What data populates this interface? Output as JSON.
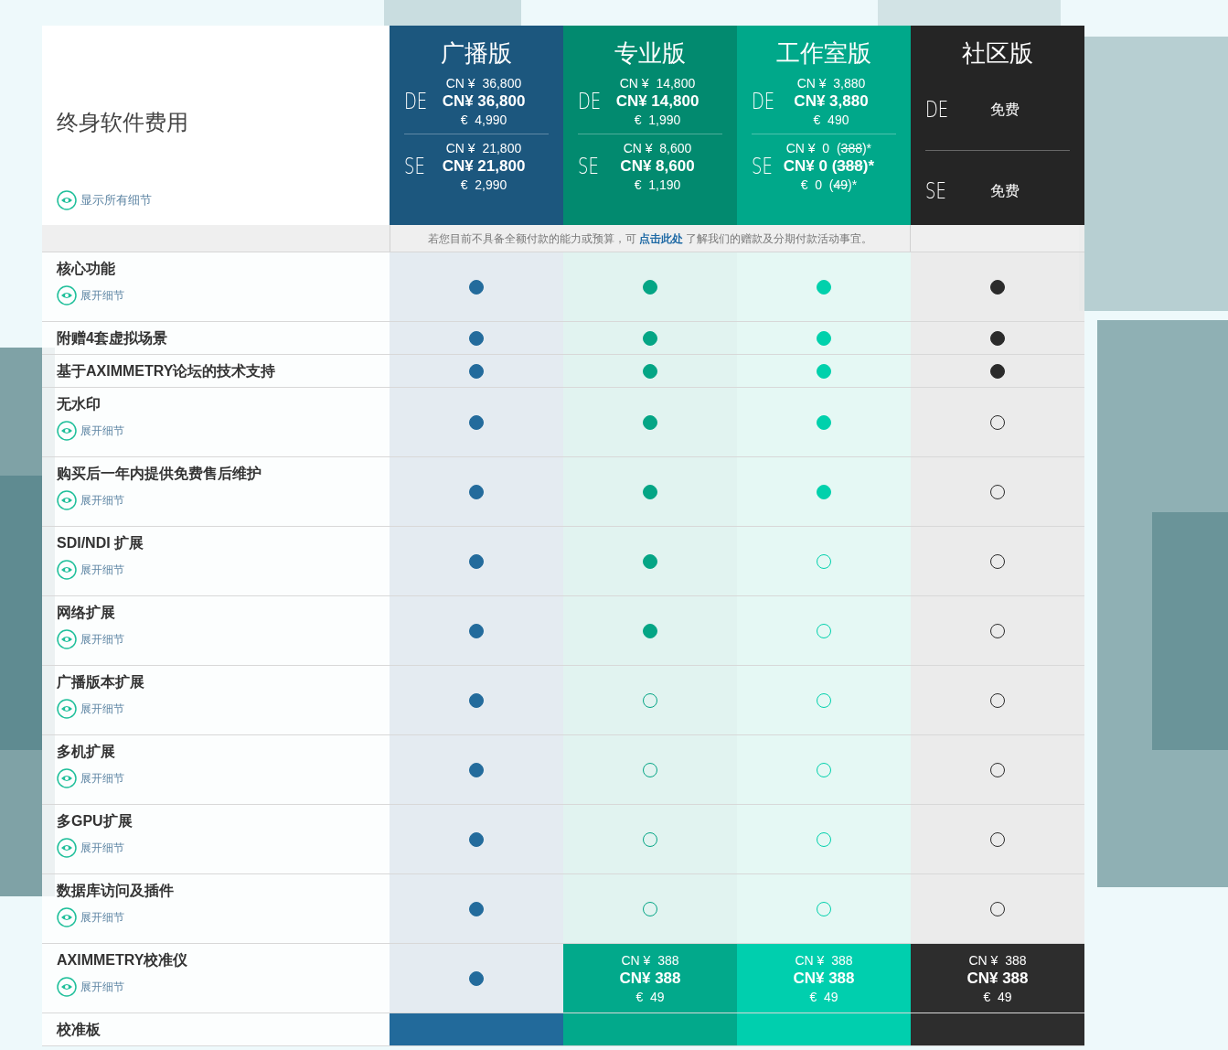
{
  "header": {
    "title": "终身软件费用",
    "show_all": "显示所有细节"
  },
  "editions": [
    {
      "name": "广播版",
      "tiers": [
        {
          "label": "DE",
          "kind": "price",
          "lines": [
            {
              "text": "CN ¥  36,800"
            },
            {
              "text": "CN¥ 36,800"
            },
            {
              "text": "€  4,990"
            }
          ]
        },
        {
          "label": "SE",
          "kind": "price",
          "lines": [
            {
              "text": "CN ¥  21,800"
            },
            {
              "text": "CN¥ 21,800"
            },
            {
              "text": "€  2,990"
            }
          ]
        }
      ]
    },
    {
      "name": "专业版",
      "tiers": [
        {
          "label": "DE",
          "kind": "price",
          "lines": [
            {
              "text": "CN ¥  14,800"
            },
            {
              "text": "CN¥ 14,800"
            },
            {
              "text": "€  1,990"
            }
          ]
        },
        {
          "label": "SE",
          "kind": "price",
          "lines": [
            {
              "text": "CN ¥  8,600"
            },
            {
              "text": "CN¥ 8,600"
            },
            {
              "text": "€  1,190"
            }
          ]
        }
      ]
    },
    {
      "name": "工作室版",
      "tiers": [
        {
          "label": "DE",
          "kind": "price",
          "lines": [
            {
              "text": "CN ¥  3,880"
            },
            {
              "text": "CN¥ 3,880"
            },
            {
              "text": "€  490"
            }
          ]
        },
        {
          "label": "SE",
          "kind": "price",
          "lines": [
            {
              "text": "CN ¥  0  (",
              "struck": "388",
              "after": ")*"
            },
            {
              "text": "CN¥ 0 (",
              "struck": "388",
              "after": ")*"
            },
            {
              "text": "€  0  (",
              "struck": "49",
              "after": ")*"
            }
          ]
        }
      ]
    },
    {
      "name": "社区版",
      "tiers": [
        {
          "label": "DE",
          "kind": "free",
          "text": "免费"
        },
        {
          "label": "SE",
          "kind": "free",
          "text": "免费"
        }
      ]
    }
  ],
  "note": {
    "before": "若您目前不具备全额付款的能力或预算，可 ",
    "link": "点击此处",
    "after": " 了解我们的赠款及分期付款活动事宜。"
  },
  "rows": [
    {
      "label": "核心功能",
      "details": "展开细节",
      "cells": [
        {
          "kind": "dot",
          "included": true
        },
        {
          "kind": "dot",
          "included": true
        },
        {
          "kind": "dot",
          "included": true
        },
        {
          "kind": "dot",
          "included": true
        }
      ]
    },
    {
      "label": "附赠4套虚拟场景",
      "cells": [
        {
          "kind": "dot",
          "included": true
        },
        {
          "kind": "dot",
          "included": true
        },
        {
          "kind": "dot",
          "included": true
        },
        {
          "kind": "dot",
          "included": true
        }
      ]
    },
    {
      "label": "基于AXIMMETRY论坛的技术支持",
      "cells": [
        {
          "kind": "dot",
          "included": true
        },
        {
          "kind": "dot",
          "included": true
        },
        {
          "kind": "dot",
          "included": true
        },
        {
          "kind": "dot",
          "included": true
        }
      ]
    },
    {
      "label": "无水印",
      "details": "展开细节",
      "cells": [
        {
          "kind": "dot",
          "included": true
        },
        {
          "kind": "dot",
          "included": true
        },
        {
          "kind": "dot",
          "included": true
        },
        {
          "kind": "dot",
          "included": false
        }
      ]
    },
    {
      "label": "购买后一年内提供免费售后维护",
      "details": "展开细节",
      "cells": [
        {
          "kind": "dot",
          "included": true
        },
        {
          "kind": "dot",
          "included": true
        },
        {
          "kind": "dot",
          "included": true
        },
        {
          "kind": "dot",
          "included": false
        }
      ]
    },
    {
      "label": "SDI/NDI 扩展",
      "details": "展开细节",
      "cells": [
        {
          "kind": "dot",
          "included": true
        },
        {
          "kind": "dot",
          "included": true
        },
        {
          "kind": "dot",
          "included": false
        },
        {
          "kind": "dot",
          "included": false
        }
      ]
    },
    {
      "label": "网络扩展",
      "details": "展开细节",
      "cells": [
        {
          "kind": "dot",
          "included": true
        },
        {
          "kind": "dot",
          "included": true
        },
        {
          "kind": "dot",
          "included": false
        },
        {
          "kind": "dot",
          "included": false
        }
      ]
    },
    {
      "label": "广播版本扩展",
      "details": "展开细节",
      "cells": [
        {
          "kind": "dot",
          "included": true
        },
        {
          "kind": "dot",
          "included": false
        },
        {
          "kind": "dot",
          "included": false
        },
        {
          "kind": "dot",
          "included": false
        }
      ]
    },
    {
      "label": "多机扩展",
      "details": "展开细节",
      "cells": [
        {
          "kind": "dot",
          "included": true
        },
        {
          "kind": "dot",
          "included": false
        },
        {
          "kind": "dot",
          "included": false
        },
        {
          "kind": "dot",
          "included": false
        }
      ]
    },
    {
      "label": "多GPU扩展",
      "details": "展开细节",
      "cells": [
        {
          "kind": "dot",
          "included": true
        },
        {
          "kind": "dot",
          "included": false
        },
        {
          "kind": "dot",
          "included": false
        },
        {
          "kind": "dot",
          "included": false
        }
      ]
    },
    {
      "label": "数据库访问及插件",
      "details": "展开细节",
      "cells": [
        {
          "kind": "dot",
          "included": true
        },
        {
          "kind": "dot",
          "included": false
        },
        {
          "kind": "dot",
          "included": false
        },
        {
          "kind": "dot",
          "included": false
        }
      ]
    },
    {
      "label": "AXIMMETRY校准仪",
      "details": "展开细节",
      "cells": [
        {
          "kind": "dot",
          "included": true
        },
        {
          "kind": "price",
          "lines": [
            {
              "text": "CN ¥  388"
            },
            {
              "text": "CN¥ 388"
            },
            {
              "text": "€  49"
            }
          ]
        },
        {
          "kind": "price",
          "lines": [
            {
              "text": "CN ¥  388"
            },
            {
              "text": "CN¥ 388"
            },
            {
              "text": "€  49"
            }
          ]
        },
        {
          "kind": "price",
          "lines": [
            {
              "text": "CN ¥  388"
            },
            {
              "text": "CN¥ 388"
            },
            {
              "text": "€  49"
            }
          ]
        }
      ]
    },
    {
      "label": "校准板",
      "cells": [
        {
          "kind": "price"
        },
        {
          "kind": "price"
        },
        {
          "kind": "price"
        },
        {
          "kind": "price"
        }
      ]
    }
  ]
}
